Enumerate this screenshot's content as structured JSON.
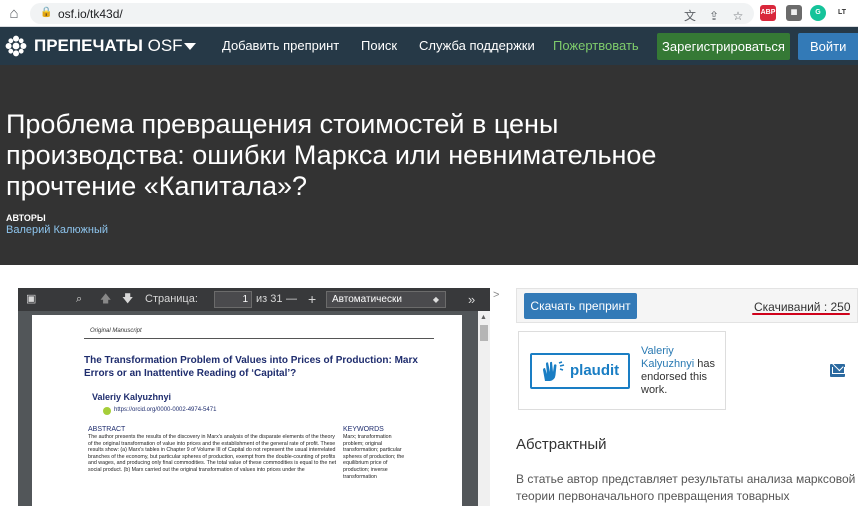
{
  "browser": {
    "url": "osf.io/tk43d/",
    "extensions": [
      {
        "name": "translate-icon",
        "label": "",
        "color": "#5f6368"
      },
      {
        "name": "share-icon",
        "label": "",
        "color": "#5f6368"
      },
      {
        "name": "bookmark-star-icon",
        "label": "",
        "color": "#5f6368"
      },
      {
        "name": "abp-extension-icon",
        "label": "ABP",
        "color": "#d9283c"
      },
      {
        "name": "extension-badge-icon",
        "label": "",
        "color": "#6b6b6b"
      },
      {
        "name": "grammarly-icon",
        "label": "G",
        "color": "#15c39a"
      },
      {
        "name": "languagetool-icon",
        "label": "LT",
        "color": "#333333"
      }
    ]
  },
  "nav": {
    "brand": "ПРЕПЕЧАТЫ",
    "brand_suffix": "OSF",
    "items": [
      "Добавить препринт",
      "Поиск",
      "Служба поддержки"
    ],
    "donate": "Пожертвовать",
    "register": "Зарегистрироваться",
    "login": "Войти"
  },
  "header": {
    "title": "Проблема превращения стоимостей в цены производства: ошибки Маркса или невнимательное прочтение «Капитала»?",
    "authors_label": "АВТОРЫ",
    "author": "Валерий Калюжный"
  },
  "pdf": {
    "page_label": "Страница:",
    "page_current": "1",
    "page_total": "из 31",
    "zoom": "Автоматически",
    "doc": {
      "manuscript_label": "Original Manuscript",
      "title": "The Transformation Problem of Values into Prices of Production: Marx Errors or an Inattentive Reading of ‘Capital’?",
      "author": "Valeriy Kalyuzhnyi",
      "orcid": "https://orcid.org/0000-0002-4974-5471",
      "abstract_heading": "ABSTRACT",
      "abstract_text": "The author presents the results of the discovery in Marx's analysis of the disparate elements of the theory of the original transformation of value into prices and the establishment of the general rate of profit. These results show: (a) Marx's tables in Chapter 9 of Volume III of Capital do not represent the usual interrelated branches of the economy, but particular spheres of production, exempt from the double-counting of profits and wages, and producing only final commodities. The total value of these commodities is equal to the net social product. (b) Marx carried out the original transformation of values into prices under the",
      "keywords_heading": "KEYWORDS",
      "keywords_text": "Marx; transformation problem; original transformation; particular spheres of production; the equilibrium price of production; inverse transformation"
    }
  },
  "side": {
    "download": "Скачать препринт",
    "downloads": "Скачиваний : 250",
    "plaudit": "plaudit",
    "endorser": "Valeriy Kalyuzhnyi",
    "endorse_text": "has endorsed this work.",
    "abstract_title": "Абстрактный",
    "abstract_text": "В статье автор представляет результаты анализа марксовой теории первоначального превращения товарных стоимостей в"
  }
}
